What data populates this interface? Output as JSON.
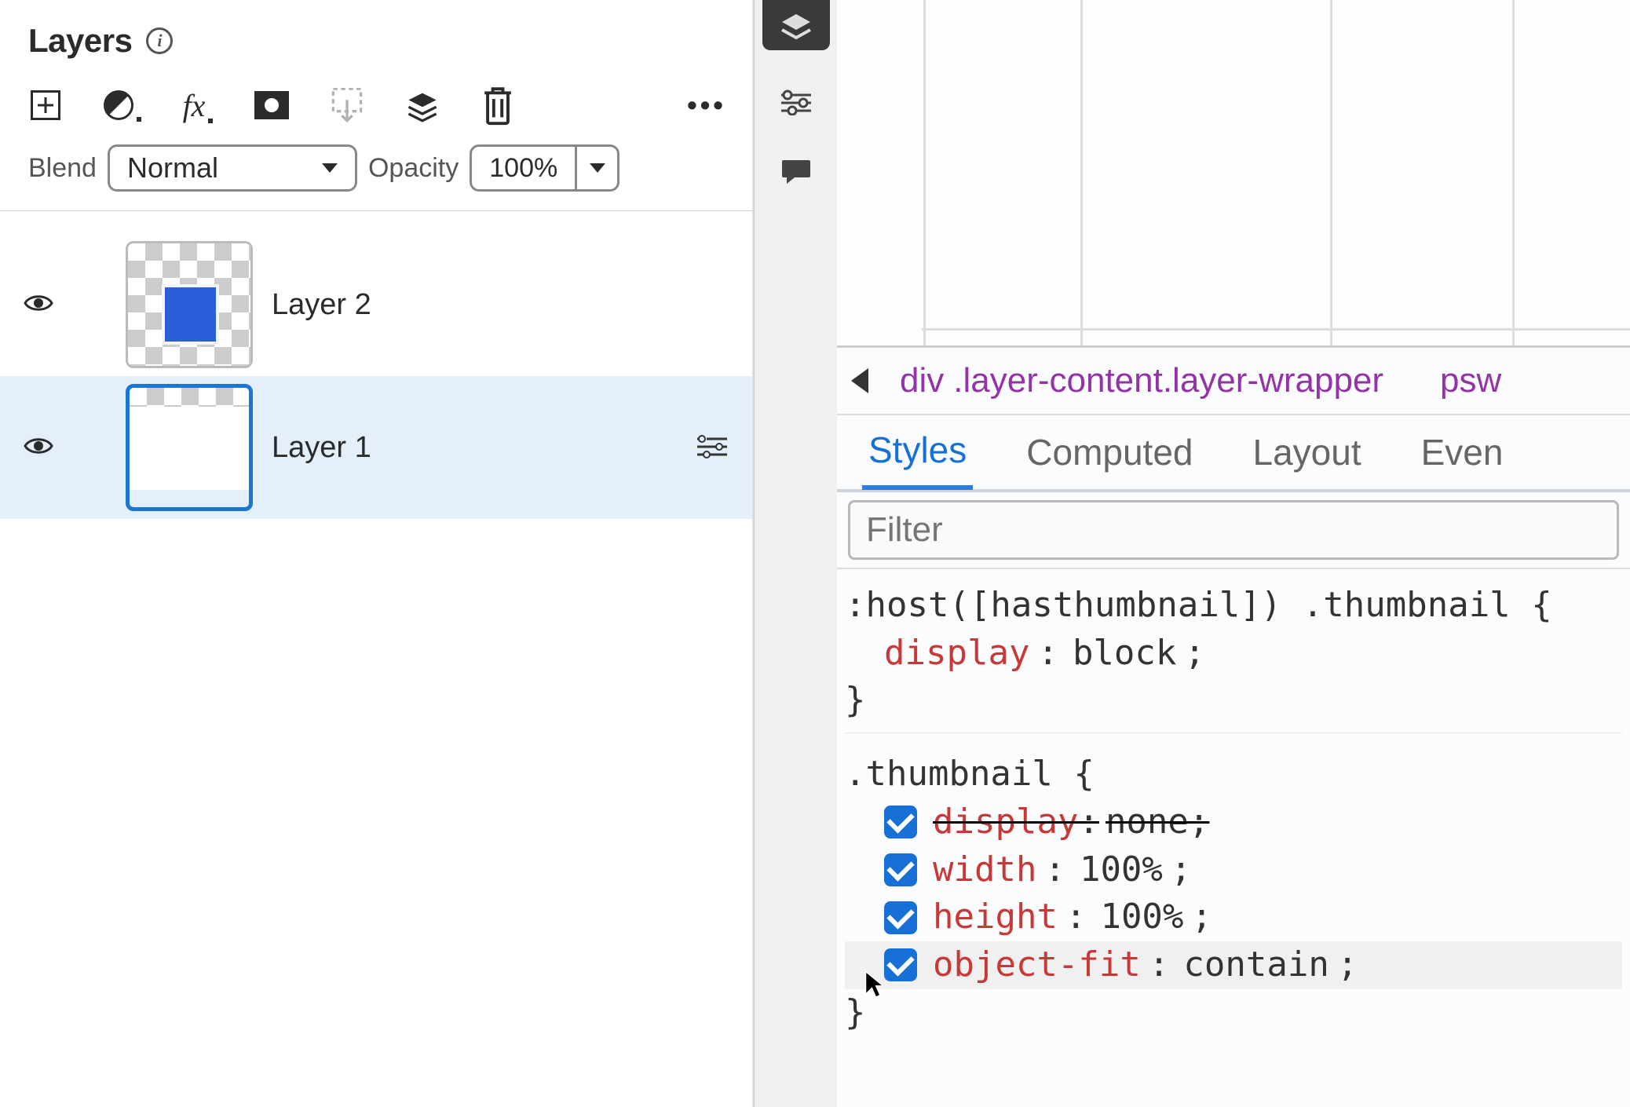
{
  "panel": {
    "title": "Layers",
    "blend_label": "Blend",
    "blend_value": "Normal",
    "opacity_label": "Opacity",
    "opacity_value": "100%"
  },
  "layers": [
    {
      "name": "Layer 2",
      "selected": false,
      "thumb": "blue"
    },
    {
      "name": "Layer 1",
      "selected": true,
      "thumb": "white"
    }
  ],
  "breadcrumb": {
    "tag": "div",
    "classes": ".layer-content.layer-wrapper",
    "next": "psw"
  },
  "tabs": [
    {
      "label": "Styles",
      "active": true
    },
    {
      "label": "Computed",
      "active": false
    },
    {
      "label": "Layout",
      "active": false
    },
    {
      "label": "Even",
      "active": false
    }
  ],
  "filter_placeholder": "Filter",
  "css": {
    "rule1": {
      "selector": ":host([hasthumbnail]) .thumbnail",
      "decls": [
        {
          "prop": "display",
          "val": "block"
        }
      ]
    },
    "rule2": {
      "selector": ".thumbnail",
      "decls": [
        {
          "prop": "display",
          "val": "none",
          "struck": true
        },
        {
          "prop": "width",
          "val": "100%"
        },
        {
          "prop": "height",
          "val": "100%"
        },
        {
          "prop": "object-fit",
          "val": "contain",
          "hovered": true
        }
      ]
    }
  }
}
